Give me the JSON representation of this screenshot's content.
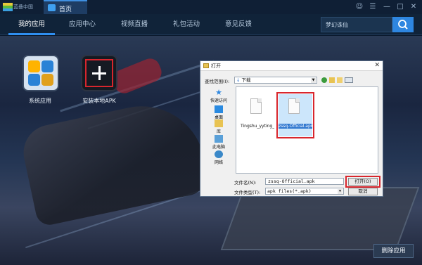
{
  "titlebar": {
    "app_name": "蓝叠中国",
    "home_tab": "首页",
    "controls": [
      "avatar-icon",
      "menu-icon",
      "minimize-icon",
      "maximize-icon",
      "close-icon"
    ]
  },
  "nav": {
    "tabs": [
      {
        "label": "我的应用",
        "active": true
      },
      {
        "label": "应用中心",
        "active": false
      },
      {
        "label": "视频直播",
        "active": false
      },
      {
        "label": "礼包活动",
        "active": false
      },
      {
        "label": "意见反馈",
        "active": false
      }
    ],
    "search_value": "梦幻诛仙",
    "accent": "#2f8ff0"
  },
  "desktop": {
    "apps": [
      {
        "label": "系统应用",
        "icon": "system-apps-icon"
      },
      {
        "label": "安装本地APK",
        "icon": "plus-icon"
      }
    ],
    "delete_label": "删除应用"
  },
  "dialog": {
    "title": "打开",
    "lookin_label": "查找范围(I):",
    "lookin_value": "下载",
    "places": [
      {
        "label": "快速访问",
        "icon": "star-icon"
      },
      {
        "label": "桌面",
        "icon": "desktop-icon"
      },
      {
        "label": "库",
        "icon": "library-icon"
      },
      {
        "label": "此电脑",
        "icon": "computer-icon"
      },
      {
        "label": "网络",
        "icon": "network-icon"
      }
    ],
    "files": [
      {
        "name": "Tingshu_yyting_...",
        "selected": false
      },
      {
        "name": "zssq-Official.apk",
        "selected": true
      }
    ],
    "filename_label": "文件名(N):",
    "filename_value": "zssq-Official.apk",
    "filetype_label": "文件类型(T):",
    "filetype_value": "apk files(*.apk)",
    "open_label": "打开(O)",
    "cancel_label": "取消",
    "highlight": "#d8262d"
  }
}
